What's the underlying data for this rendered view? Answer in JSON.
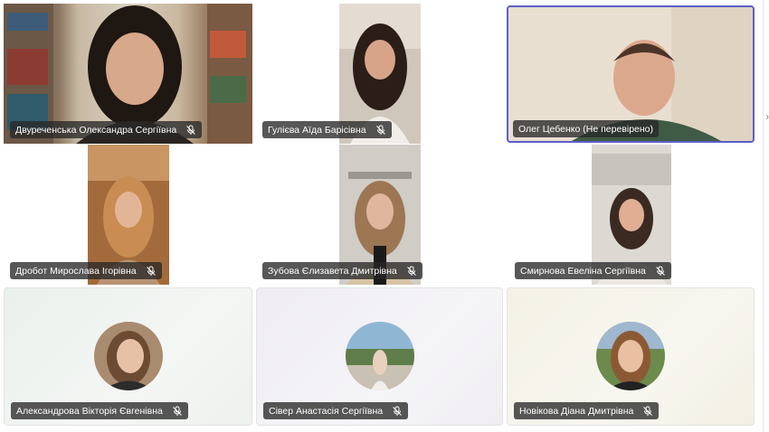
{
  "participants": [
    {
      "name": "Двуреченська Олександра Сергіївна",
      "muted": true,
      "video": true
    },
    {
      "name": "Гулієва Аїда Барісівна",
      "muted": true,
      "video": true
    },
    {
      "name": "Олег Цебенко (Не перевірено)",
      "muted": false,
      "video": true,
      "speaking": true
    },
    {
      "name": "Дробот Мирослава Ігорівна",
      "muted": true,
      "video": true
    },
    {
      "name": "Зубова Єлизавета Дмитрівна",
      "muted": true,
      "video": true
    },
    {
      "name": "Смирнова Евеліна Сергіївна",
      "muted": true,
      "video": true
    },
    {
      "name": "Александрова Вікторія Євгенівна",
      "muted": true,
      "video": false
    },
    {
      "name": "Сівер Анастасія Сергіївна",
      "muted": true,
      "video": false
    },
    {
      "name": "Новікова Діана Дмитрівна",
      "muted": true,
      "video": false
    }
  ],
  "colors": {
    "accent": "#5b5fc7",
    "name_tag_bg": "#282828",
    "tile_tint_1": "#eef3ef",
    "tile_tint_2": "#f0eef3",
    "tile_tint_3": "#f3f1e8"
  },
  "icons": {
    "mute": "mic-off-icon",
    "scroll": "chevron-right-icon"
  }
}
